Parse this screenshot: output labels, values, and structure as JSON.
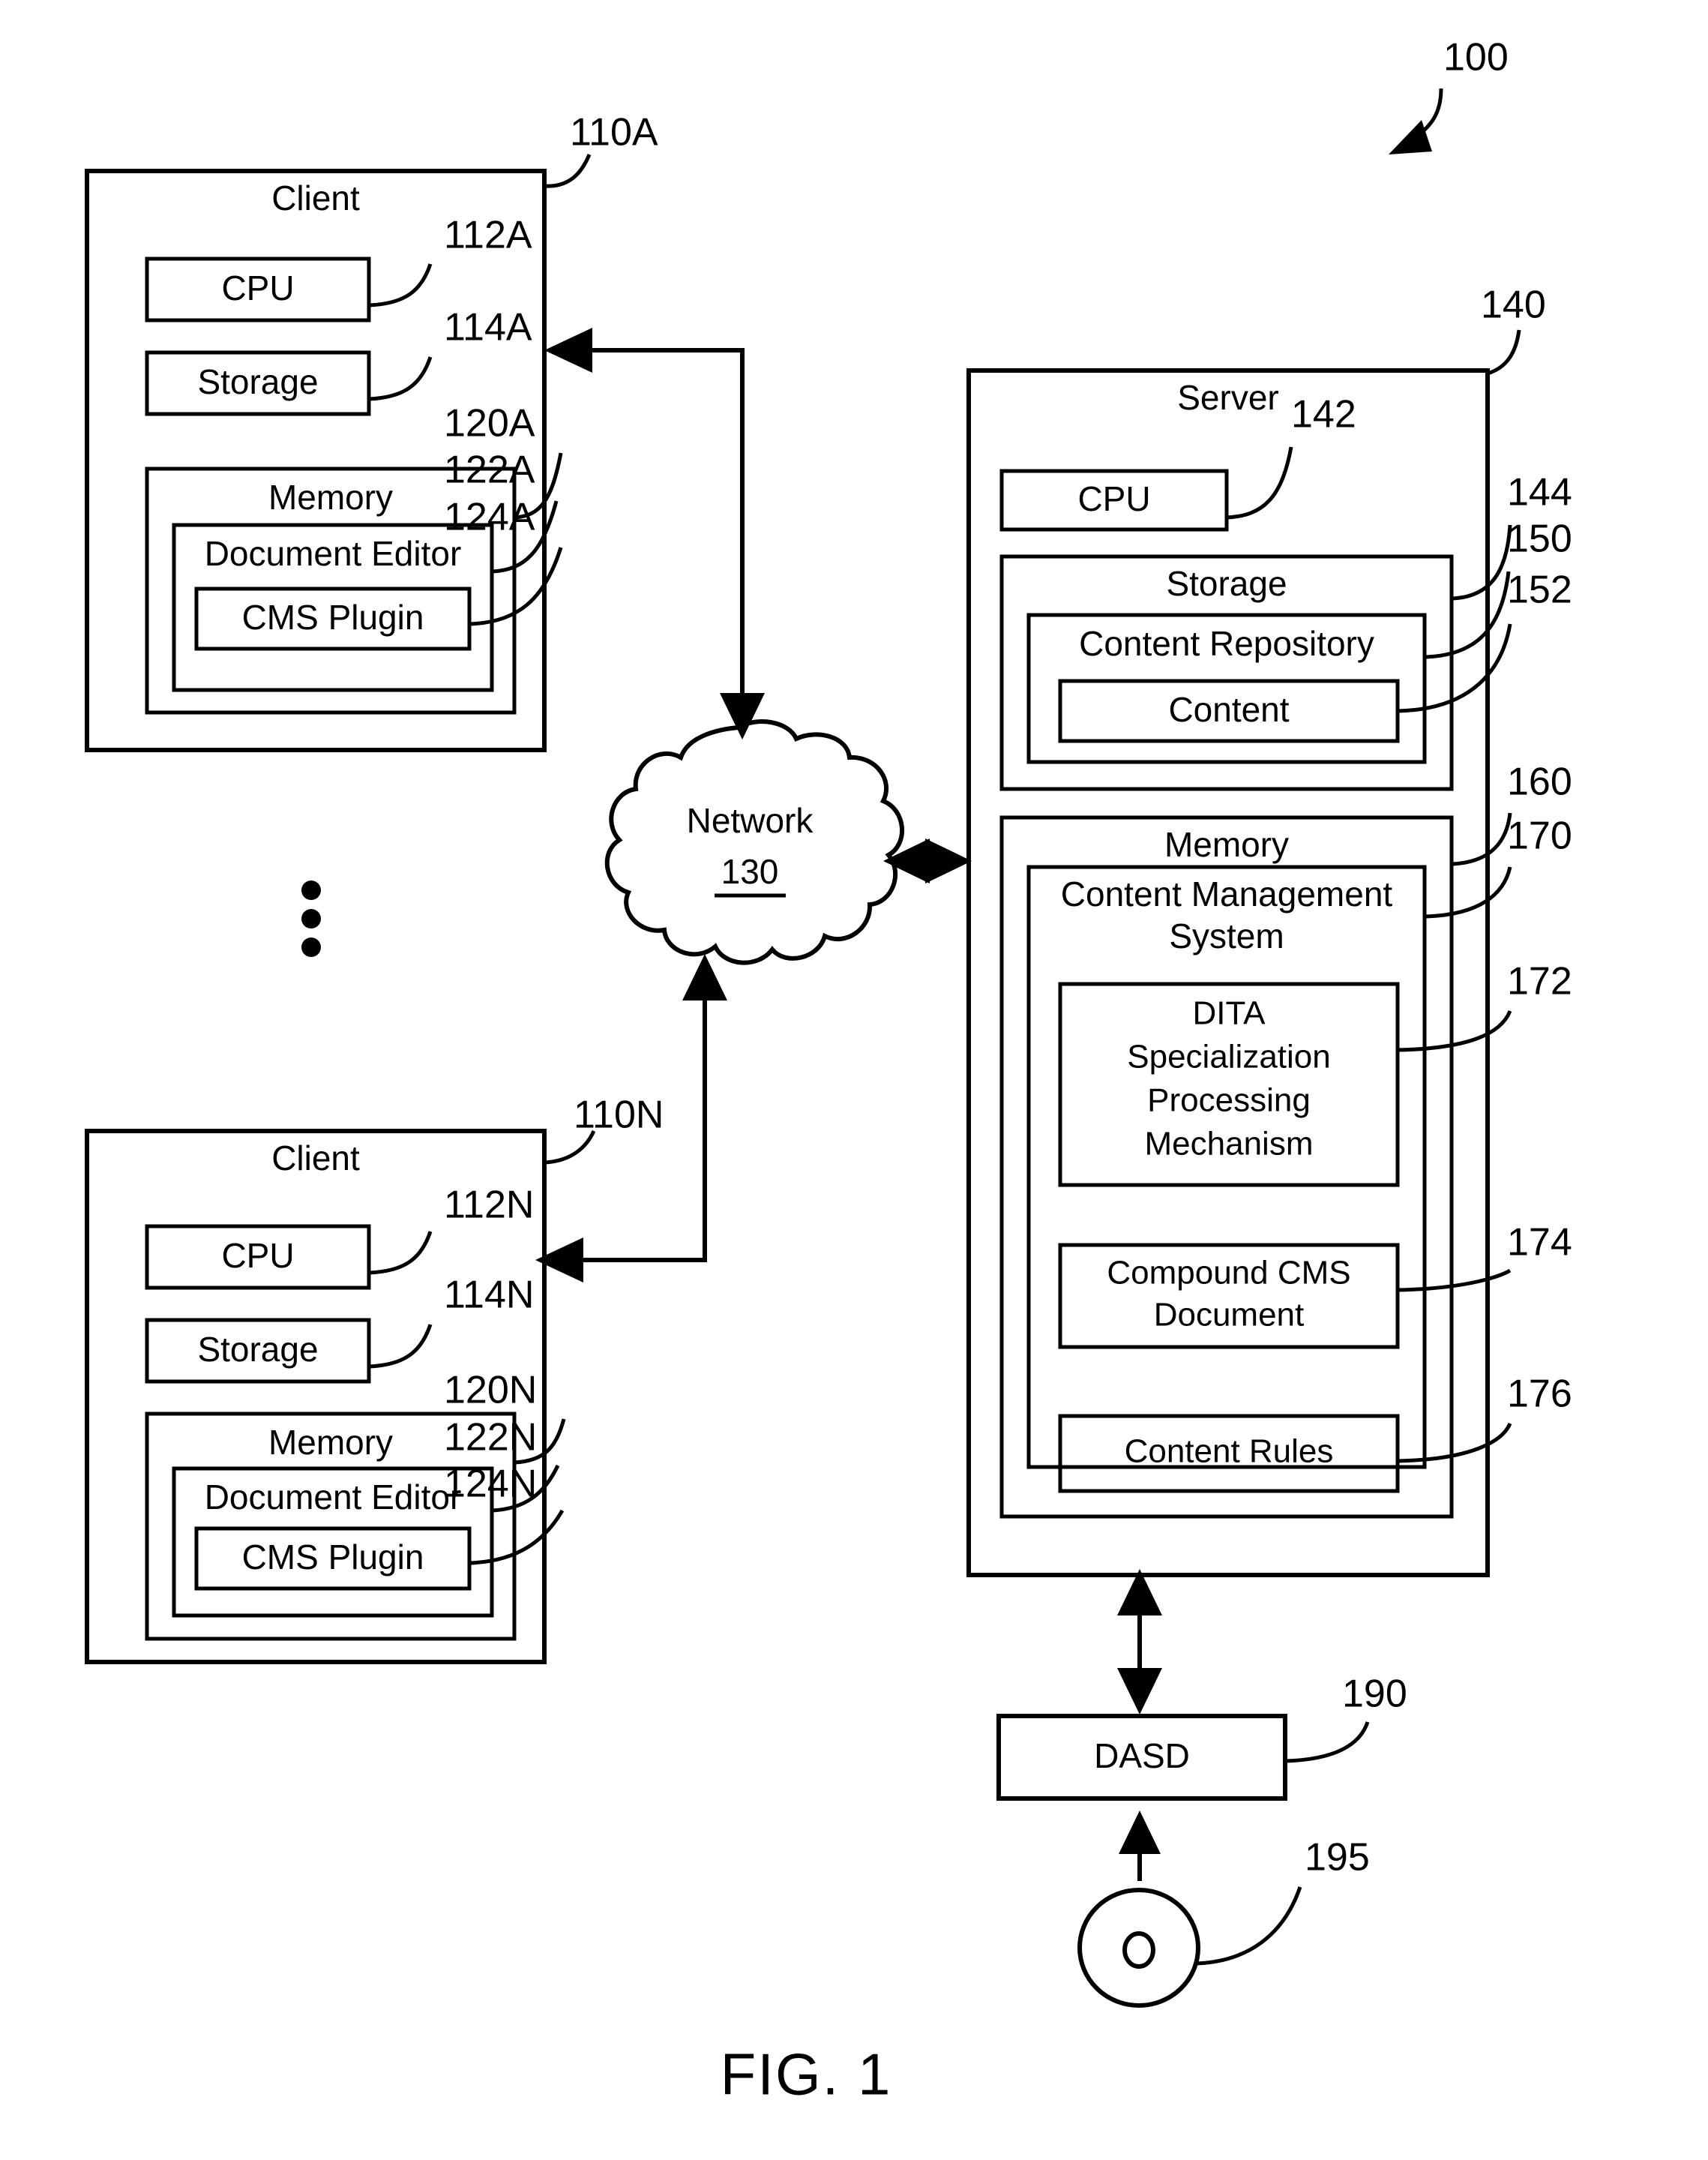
{
  "figure": {
    "caption": "FIG. 1",
    "system_numeral": "100"
  },
  "clients": [
    {
      "id": "client-a",
      "title": "Client",
      "numeral": "110A",
      "cpu": {
        "label": "CPU",
        "numeral": "112A"
      },
      "storage": {
        "label": "Storage",
        "numeral": "114A"
      },
      "memory": {
        "label": "Memory",
        "numeral": "120A",
        "document_editor": {
          "label": "Document Editor",
          "numeral": "122A",
          "cms_plugin": {
            "label": "CMS Plugin",
            "numeral": "124A"
          }
        }
      }
    },
    {
      "id": "client-n",
      "title": "Client",
      "numeral": "110N",
      "cpu": {
        "label": "CPU",
        "numeral": "112N"
      },
      "storage": {
        "label": "Storage",
        "numeral": "114N"
      },
      "memory": {
        "label": "Memory",
        "numeral": "120N",
        "document_editor": {
          "label": "Document Editor",
          "numeral": "122N",
          "cms_plugin": {
            "label": "CMS Plugin",
            "numeral": "124N"
          }
        }
      }
    }
  ],
  "network": {
    "label": "Network",
    "numeral": "130"
  },
  "server": {
    "title": "Server",
    "numeral": "140",
    "cpu": {
      "label": "CPU",
      "numeral": "142"
    },
    "storage": {
      "label": "Storage",
      "numeral": "144",
      "content_repository": {
        "label": "Content Repository",
        "numeral": "150",
        "content": {
          "label": "Content",
          "numeral": "152"
        }
      }
    },
    "memory": {
      "label": "Memory",
      "numeral": "160",
      "cms": {
        "label_line1": "Content Management",
        "label_line2": "System",
        "numeral": "170",
        "dita": {
          "label_line1": "DITA",
          "label_line2": "Specialization",
          "label_line3": "Processing",
          "label_line4": "Mechanism",
          "numeral": "172"
        },
        "compound_doc": {
          "label_line1": "Compound CMS",
          "label_line2": "Document",
          "numeral": "174"
        },
        "content_rules": {
          "label": "Content Rules",
          "numeral": "176"
        }
      }
    }
  },
  "dasd": {
    "label": "DASD",
    "numeral": "190"
  },
  "removable_media": {
    "numeral": "195"
  },
  "colors": {
    "ink": "#000000",
    "paper": "#ffffff"
  }
}
